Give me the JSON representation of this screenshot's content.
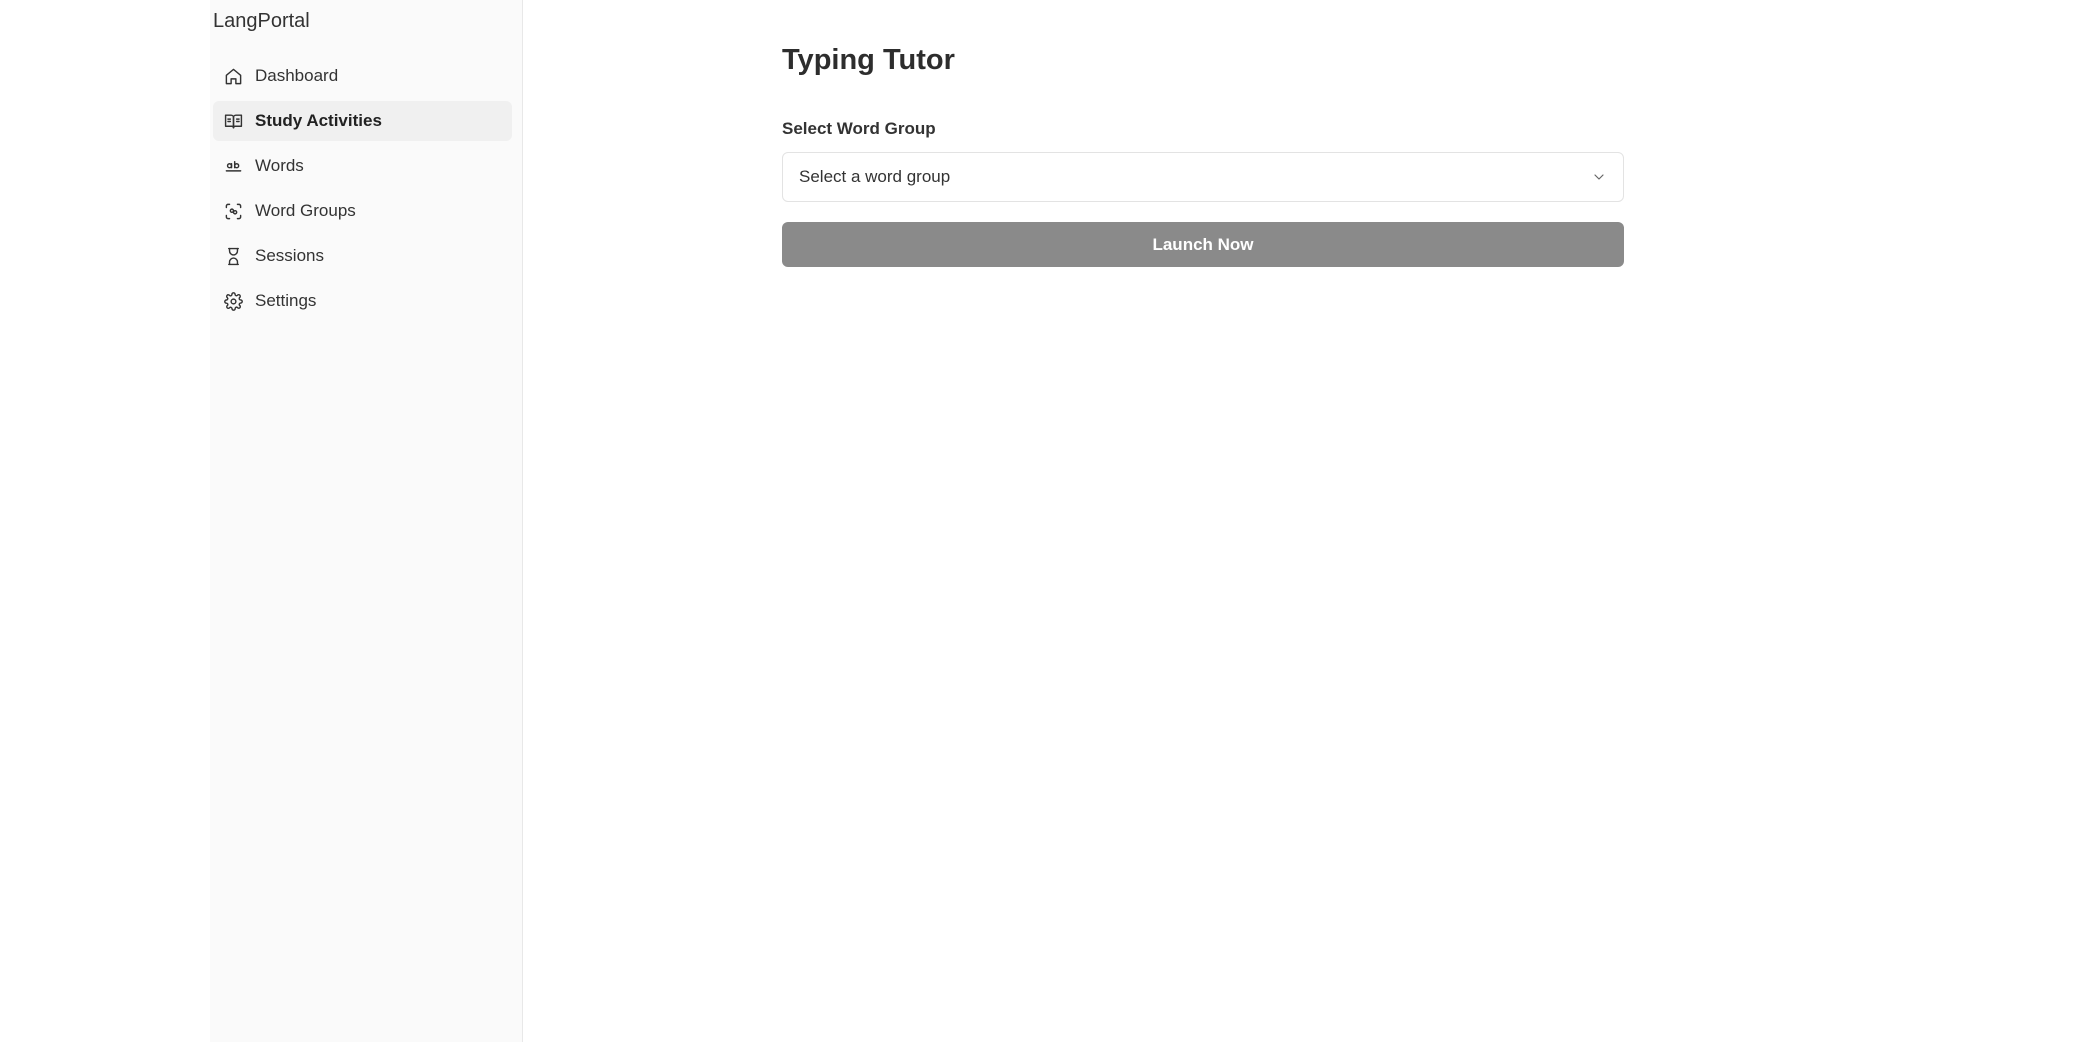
{
  "app": {
    "brand": "LangPortal"
  },
  "sidebar": {
    "items": [
      {
        "label": "Dashboard",
        "icon": "home-icon",
        "active": false
      },
      {
        "label": "Study Activities",
        "icon": "book-open-icon",
        "active": true
      },
      {
        "label": "Words",
        "icon": "whole-word-icon",
        "active": false
      },
      {
        "label": "Word Groups",
        "icon": "word-groups-icon",
        "active": false
      },
      {
        "label": "Sessions",
        "icon": "hourglass-icon",
        "active": false
      },
      {
        "label": "Settings",
        "icon": "gear-icon",
        "active": false
      }
    ]
  },
  "main": {
    "title": "Typing Tutor",
    "word_group": {
      "label": "Select Word Group",
      "placeholder": "Select a word group"
    },
    "launch_label": "Launch Now"
  },
  "colors": {
    "sidebar_bg": "#fafafa",
    "active_item_bg": "#f0f0f0",
    "button_bg": "#8a8a8a",
    "text": "#333333"
  }
}
